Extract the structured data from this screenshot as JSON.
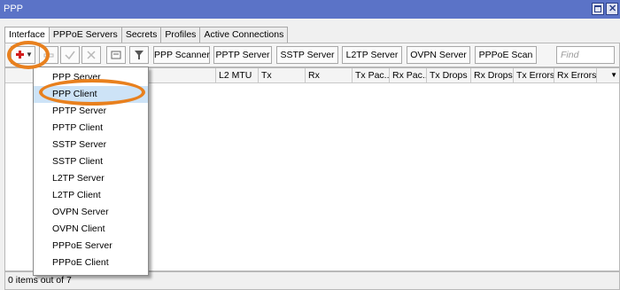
{
  "window": {
    "title": "PPP"
  },
  "tabs": [
    {
      "label": "Interface",
      "active": true
    },
    {
      "label": "PPPoE Servers",
      "active": false
    },
    {
      "label": "Secrets",
      "active": false
    },
    {
      "label": "Profiles",
      "active": false
    },
    {
      "label": "Active Connections",
      "active": false
    }
  ],
  "toolbar": {
    "icons": [
      "add-icon",
      "remove-icon",
      "enable-check-icon",
      "disable-x-icon",
      "comment-icon",
      "filter-icon"
    ],
    "buttons": [
      "PPP Scanner",
      "PPTP Server",
      "SSTP Server",
      "L2TP Server",
      "OVPN Server",
      "PPPoE Scan"
    ],
    "find_placeholder": "Find"
  },
  "table": {
    "columns": [
      "L2 MTU",
      "Tx",
      "Rx",
      "Tx Pac...",
      "Rx Pac...",
      "Tx Drops",
      "Rx Drops",
      "Tx Errors",
      "Rx Errors"
    ],
    "rows": []
  },
  "menu": {
    "items": [
      "PPP Server",
      "PPP Client",
      "PPTP Server",
      "PPTP Client",
      "SSTP Server",
      "SSTP Client",
      "L2TP Server",
      "L2TP Client",
      "OVPN Server",
      "OVPN Client",
      "PPPoE Server",
      "PPPoE Client"
    ],
    "highlighted": "PPP Client"
  },
  "status": {
    "text": "0 items out of 7"
  },
  "colors": {
    "titlebar": "#5b73c7",
    "highlight_ring": "#e8801e",
    "add_icon": "#d21b1b",
    "menu_highlight": "#cde3f7"
  }
}
